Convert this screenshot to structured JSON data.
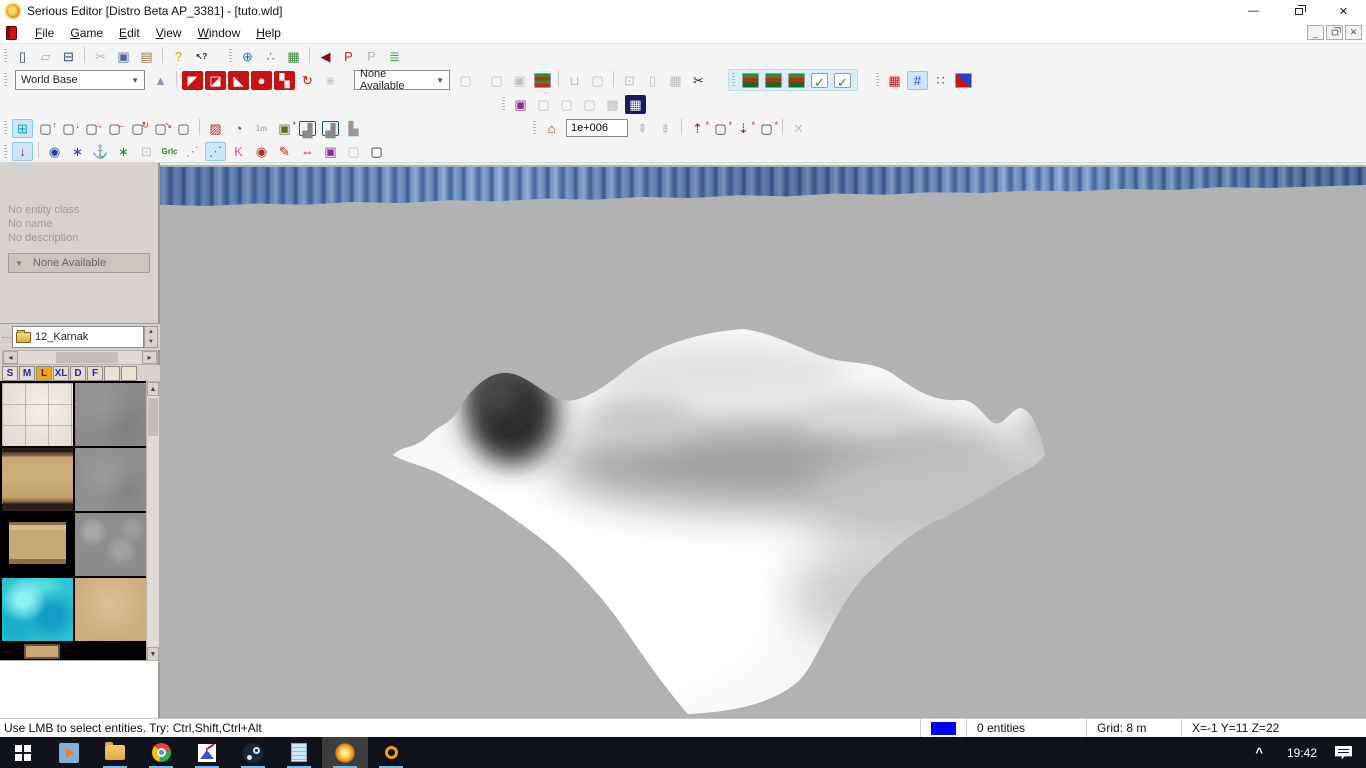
{
  "window": {
    "title": "Serious Editor [Distro Beta AP_3381] - [tuto.wld]",
    "app_icon": "serious-sun",
    "controls": {
      "minimize": "—",
      "restore": "double-square",
      "close": "✕"
    },
    "mdi_controls": {
      "minimize": "_",
      "restore": "double-square",
      "close": "✕"
    }
  },
  "menu": {
    "items": [
      "File",
      "Game",
      "Edit",
      "View",
      "Window",
      "Help"
    ]
  },
  "toolbars": {
    "world_base_combo": "World Base",
    "none_available_combo": "None Available",
    "mip_value": "1e+006",
    "row1_file": [
      {
        "n": "new-file-icon",
        "g": "▯",
        "c": "#334455"
      },
      {
        "n": "open-file-icon",
        "g": "▱",
        "c": "#d8a820"
      },
      {
        "n": "save-file-icon",
        "g": "⊟",
        "c": "#334466"
      },
      {
        "sep": true
      },
      {
        "n": "cut-icon",
        "g": "✂",
        "c": "#b0b0b0",
        "d": true
      },
      {
        "n": "copy-icon",
        "g": "▣",
        "c": "#556699"
      },
      {
        "n": "paste-icon",
        "g": "▤",
        "c": "#997744"
      },
      {
        "sep": true
      },
      {
        "n": "help-icon",
        "g": "?",
        "c": "#d8a000"
      },
      {
        "n": "context-help-icon",
        "g": "↖?",
        "c": "#222222",
        "small": true
      }
    ],
    "row1_browsers": [
      {
        "n": "world-globe-icon",
        "g": "⊕",
        "c": "#1a70c0"
      },
      {
        "n": "entity-spheres-icon",
        "g": "∴",
        "c": "#cc4422"
      },
      {
        "n": "texture-image-icon",
        "g": "▦",
        "c": "#3a8a3a"
      },
      {
        "sep": true
      },
      {
        "n": "sound-speaker-icon",
        "g": "◀",
        "c": "#7a1414"
      },
      {
        "n": "particle-p-red-icon",
        "g": "P",
        "c": "#cc2222"
      },
      {
        "n": "particle-p-gray-icon",
        "g": "P",
        "c": "#b0b0b0",
        "d": true
      },
      {
        "n": "script-list-icon",
        "g": "≣",
        "c": "#2faf2f"
      }
    ],
    "row2_csg": [
      {
        "n": "primitive-pyramid-icon",
        "g": "▲",
        "c": "#8898b8"
      },
      {
        "sep": true
      },
      {
        "n": "csg-add-icon",
        "g": "◤",
        "c": "#ffffff",
        "bg": "#c41414"
      },
      {
        "n": "csg-subtract-icon",
        "g": "◪",
        "c": "#ffffff",
        "bg": "#c41414"
      },
      {
        "n": "csg-split-icon",
        "g": "◣",
        "c": "#ffffff",
        "bg": "#c41414"
      },
      {
        "n": "csg-sphere-icon",
        "g": "●",
        "c": "#f8f8f8",
        "bg": "#c41414"
      },
      {
        "n": "csg-checker-icon",
        "g": "▚",
        "c": "#ffffff",
        "bg": "#c41414"
      },
      {
        "n": "csg-copy-icon",
        "g": "↻",
        "c": "#c41414"
      },
      {
        "n": "csg-wand-icon",
        "g": "⋇",
        "c": "#c0c0c0",
        "d": true
      }
    ],
    "row2_template": [
      {
        "n": "template-cube-icon",
        "g": "▢",
        "c": "#b8b8b8",
        "d": true
      }
    ],
    "row2_edit": [
      {
        "n": "cube-pair-icon",
        "g": "▢",
        "c": "#b8b8b8",
        "d": true
      },
      {
        "n": "cube-stack-icon",
        "g": "▣",
        "c": "#b8b8b8",
        "d": true
      },
      {
        "n": "layer-split-icon",
        "bg": "linear-gradient(180deg,#2f8f2f 0 30%,#cc2222 30% 50%,#2f8f2f 50% 70%,#cc2222 70% 100%)",
        "border": true
      },
      {
        "sep": true
      },
      {
        "n": "mug-icon",
        "g": "⊔",
        "c": "#b8b8b8",
        "d": true
      },
      {
        "n": "cube-outline-icon",
        "g": "▢",
        "c": "#b8b8b8",
        "d": true
      },
      {
        "sep": true
      },
      {
        "n": "window-cube-icon",
        "g": "⊡",
        "c": "#b8b8b8",
        "d": true
      },
      {
        "n": "column-icon",
        "g": "▯",
        "c": "#b8b8b8",
        "d": true
      },
      {
        "n": "grid-cube-icon",
        "g": "▦",
        "c": "#b8b8b8",
        "d": true
      },
      {
        "n": "scissors-icon",
        "g": "✂",
        "c": "#202840"
      }
    ],
    "row2_layers": [
      {
        "n": "layer-stack-a-icon",
        "bg": "linear-gradient(180deg,#2f8f2f 0 35%,#cc2222 35% 60%,#1a6a1a 60% 100%)",
        "border": true
      },
      {
        "n": "layer-stack-b-icon",
        "bg": "linear-gradient(180deg,#2f8f2f 0 35%,#cc2222 35% 60%,#1a6a1a 60% 100%)",
        "border": true
      },
      {
        "n": "layer-stack-c-icon",
        "bg": "linear-gradient(180deg,#2f8f2f 0 35%,#cc2222 35% 60%,#1a6a1a 60% 100%)",
        "border": true
      },
      {
        "n": "check-page-a-icon",
        "g": "✓",
        "c": "#1a8a1a",
        "bg": "#ffffff",
        "border": true
      },
      {
        "n": "check-page-b-icon",
        "g": "✓",
        "c": "#1a8a1a",
        "bg": "#ffffff",
        "border": true
      }
    ],
    "row2_grid": [
      {
        "n": "selection-block-icon",
        "g": "▦",
        "c": "#c41414"
      },
      {
        "n": "hash-grid-icon",
        "g": "#",
        "c": "#2255cc",
        "s": true
      },
      {
        "n": "dot-grid-icon",
        "g": "∷",
        "c": "#2255cc"
      },
      {
        "n": "color-blocks-icon",
        "bg": "linear-gradient(45deg,#c41414 50%,#2244cc 50%)",
        "border": true
      }
    ],
    "row3_render": [
      {
        "n": "portal-cube-icon",
        "g": "▣",
        "c": "#8b2f97"
      },
      {
        "n": "flat-screen-icon",
        "g": "▢",
        "c": "#b8b8b8",
        "d": true
      },
      {
        "n": "textured-cube-a-icon",
        "g": "▢",
        "c": "#b8b8b8",
        "d": true
      },
      {
        "n": "textured-cube-b-icon",
        "g": "▢",
        "c": "#b8b8b8",
        "d": true
      },
      {
        "n": "wire-cube-icon",
        "g": "▩",
        "c": "#b8b8b8",
        "d": true
      },
      {
        "n": "console-table-icon",
        "g": "▦",
        "c": "#ffffff",
        "bg": "#1a1a5e"
      }
    ],
    "row4_cubes": [
      {
        "n": "snap-grid-icon",
        "g": "⊞",
        "c": "#18a0b8",
        "s": true
      },
      {
        "n": "stretch-up-icon",
        "g": "▢",
        "c": "#444444",
        "a": "↑"
      },
      {
        "n": "stretch-down-icon",
        "g": "▢",
        "c": "#444444",
        "a": "↓"
      },
      {
        "n": "stretch-right-icon",
        "g": "▢",
        "c": "#444444",
        "a": "→"
      },
      {
        "n": "stretch-left-icon",
        "g": "▢",
        "c": "#444444",
        "a": "←"
      },
      {
        "n": "rotate-cube-icon",
        "g": "▢",
        "c": "#444444",
        "a": "↻"
      },
      {
        "n": "corner-cube-icon",
        "g": "▢",
        "c": "#444444",
        "a": "↘"
      },
      {
        "n": "plain-cube-icon",
        "g": "▢",
        "c": "#444444"
      },
      {
        "sep": true
      },
      {
        "n": "texture-paint-icon",
        "g": "▨",
        "c": "#b03030"
      },
      {
        "n": "time-walk-icon",
        "g": "◔",
        "c": "#884400"
      },
      {
        "n": "measure-1m-icon",
        "g": "1m",
        "c": "#aaaaaa",
        "d": true,
        "small": true
      },
      {
        "n": "snapshot-camera-icon",
        "g": "▣",
        "c": "#5a6a2a",
        "a": "*"
      },
      {
        "n": "test-game-window-icon",
        "g": "▟",
        "c": "#888888",
        "bc": "#2244cc",
        "border": true
      },
      {
        "n": "test-game-full-icon",
        "g": "▟",
        "c": "#888888",
        "bc": "#2244cc",
        "border": true
      },
      {
        "n": "joystick-icon",
        "g": "▙",
        "c": "#999999"
      }
    ],
    "row4_mip_left": [
      {
        "n": "mip-home-icon",
        "g": "⌂",
        "c": "#c41414"
      }
    ],
    "row4_mip_right": [
      {
        "n": "mip-up-icon",
        "g": "⇞",
        "c": "#b8b8b8",
        "d": true
      },
      {
        "n": "mip-down-icon",
        "g": "⇟",
        "c": "#b8b8b8",
        "d": true
      },
      {
        "sep": true
      },
      {
        "n": "spawn-arrow-up-icon",
        "g": "⇡",
        "c": "#c41414",
        "a": "*"
      },
      {
        "n": "spawn-cube-up-icon",
        "g": "▢",
        "c": "#333333",
        "a": "*"
      },
      {
        "n": "spawn-arrow-down-icon",
        "g": "⇣",
        "c": "#c41414",
        "a": "*"
      },
      {
        "n": "spawn-cube-down-icon",
        "g": "▢",
        "c": "#333333",
        "a": "*"
      },
      {
        "sep": true
      },
      {
        "n": "delete-cross-icon",
        "g": "✕",
        "c": "#b8b8b8",
        "d": true
      }
    ],
    "row5_select": [
      {
        "n": "gravity-arrow-icon",
        "g": "↓",
        "c": "#c41414",
        "s": true
      },
      {
        "sep": true
      },
      {
        "n": "view-eye-icon",
        "g": "◉",
        "c": "#2244aa"
      },
      {
        "n": "star-blue-icon",
        "g": "∗",
        "c": "#2233bb"
      },
      {
        "n": "anchor-icon",
        "g": "⚓",
        "c": "#c41414"
      },
      {
        "n": "star-green-icon",
        "g": "∗",
        "c": "#1a8a1a"
      },
      {
        "n": "link-cube-icon",
        "g": "⊡",
        "c": "#b8b8b8",
        "d": true
      },
      {
        "n": "grid-lock-icon",
        "g": "Grlc",
        "c": "#1a8a1a",
        "small": true
      },
      {
        "n": "path-dots-pink-icon",
        "g": "⋰",
        "c": "#e060c0"
      },
      {
        "n": "path-dots-green-icon",
        "g": "⋰",
        "c": "#2f9f2f",
        "s": true
      },
      {
        "n": "key-pink-icon",
        "g": "K",
        "c": "#e0509a"
      },
      {
        "n": "entity-eye-icon",
        "g": "◉",
        "c": "#aa3322"
      },
      {
        "n": "paint-pencil-icon",
        "g": "✎",
        "c": "#c41414"
      },
      {
        "n": "mirror-flip-icon",
        "g": "⇔",
        "c": "#c41414"
      },
      {
        "n": "cube-purple-icon",
        "g": "▣",
        "c": "#8b2f97"
      },
      {
        "n": "cube-gray-icon",
        "g": "▢",
        "c": "#b8b8b8",
        "d": true
      },
      {
        "n": "cube-black-icon",
        "g": "▢",
        "c": "#222222"
      }
    ]
  },
  "entity_panel": {
    "lines": [
      "No entity class",
      "No name",
      "No description"
    ],
    "dropdown_label": "None Available"
  },
  "texture_browser": {
    "current_folder": "12_Karnak",
    "size_tabs": [
      "S",
      "M",
      "L",
      "XL",
      "D",
      "F",
      "",
      ""
    ],
    "selected_tab_index": 2,
    "textures": [
      {
        "n": "texture-stone-tiles",
        "cls": "tex-tiles"
      },
      {
        "n": "texture-gray-stone",
        "cls": "tex-graystone"
      },
      {
        "n": "texture-tan-wall",
        "cls": "tex-tanwall"
      },
      {
        "n": "texture-gray-rough",
        "cls": "tex-grayrough"
      },
      {
        "n": "texture-tan-plaque",
        "cls": "tex-plaque"
      },
      {
        "n": "texture-gray-cracked",
        "cls": "tex-graycrack"
      },
      {
        "n": "texture-cyan-water",
        "cls": "tex-water"
      },
      {
        "n": "texture-sand",
        "cls": "tex-sand"
      }
    ]
  },
  "viewport": {
    "background_color": "#b2b2b2",
    "sky_band_colors": [
      "#46689f",
      "#9ab5da",
      "#3c5d95"
    ],
    "terrain": "grayscale-heightmap"
  },
  "statusbar": {
    "hint": "Use LMB to select entities. Try: Ctrl,Shift,Ctrl+Alt",
    "selection_color": "#0000f0",
    "entities": "0 entities",
    "grid": "Grid: 8 m",
    "coords": "X=-1 Y=11 Z=22"
  },
  "taskbar": {
    "items": [
      {
        "n": "start-button",
        "cls": "ic-start",
        "run": false,
        "act": false
      },
      {
        "n": "media-player-icon",
        "cls": "ic-media",
        "run": false,
        "act": false
      },
      {
        "n": "file-explorer-icon",
        "cls": "ic-folder",
        "run": true,
        "act": false
      },
      {
        "n": "chrome-icon",
        "cls": "ic-chrome",
        "run": true,
        "act": false
      },
      {
        "n": "image-editor-icon",
        "cls": "ic-photos",
        "run": true,
        "act": false
      },
      {
        "n": "steam-icon",
        "cls": "ic-steam",
        "run": true,
        "act": false
      },
      {
        "n": "notepad-icon",
        "cls": "ic-notepad",
        "run": true,
        "act": false
      },
      {
        "n": "serious-editor-icon",
        "cls": "ic-editor",
        "run": true,
        "act": true
      },
      {
        "n": "serious-sam-icon",
        "cls": "ic-ring",
        "run": true,
        "act": false
      }
    ],
    "tray": {
      "chevron": "^",
      "time": "19:42"
    }
  }
}
